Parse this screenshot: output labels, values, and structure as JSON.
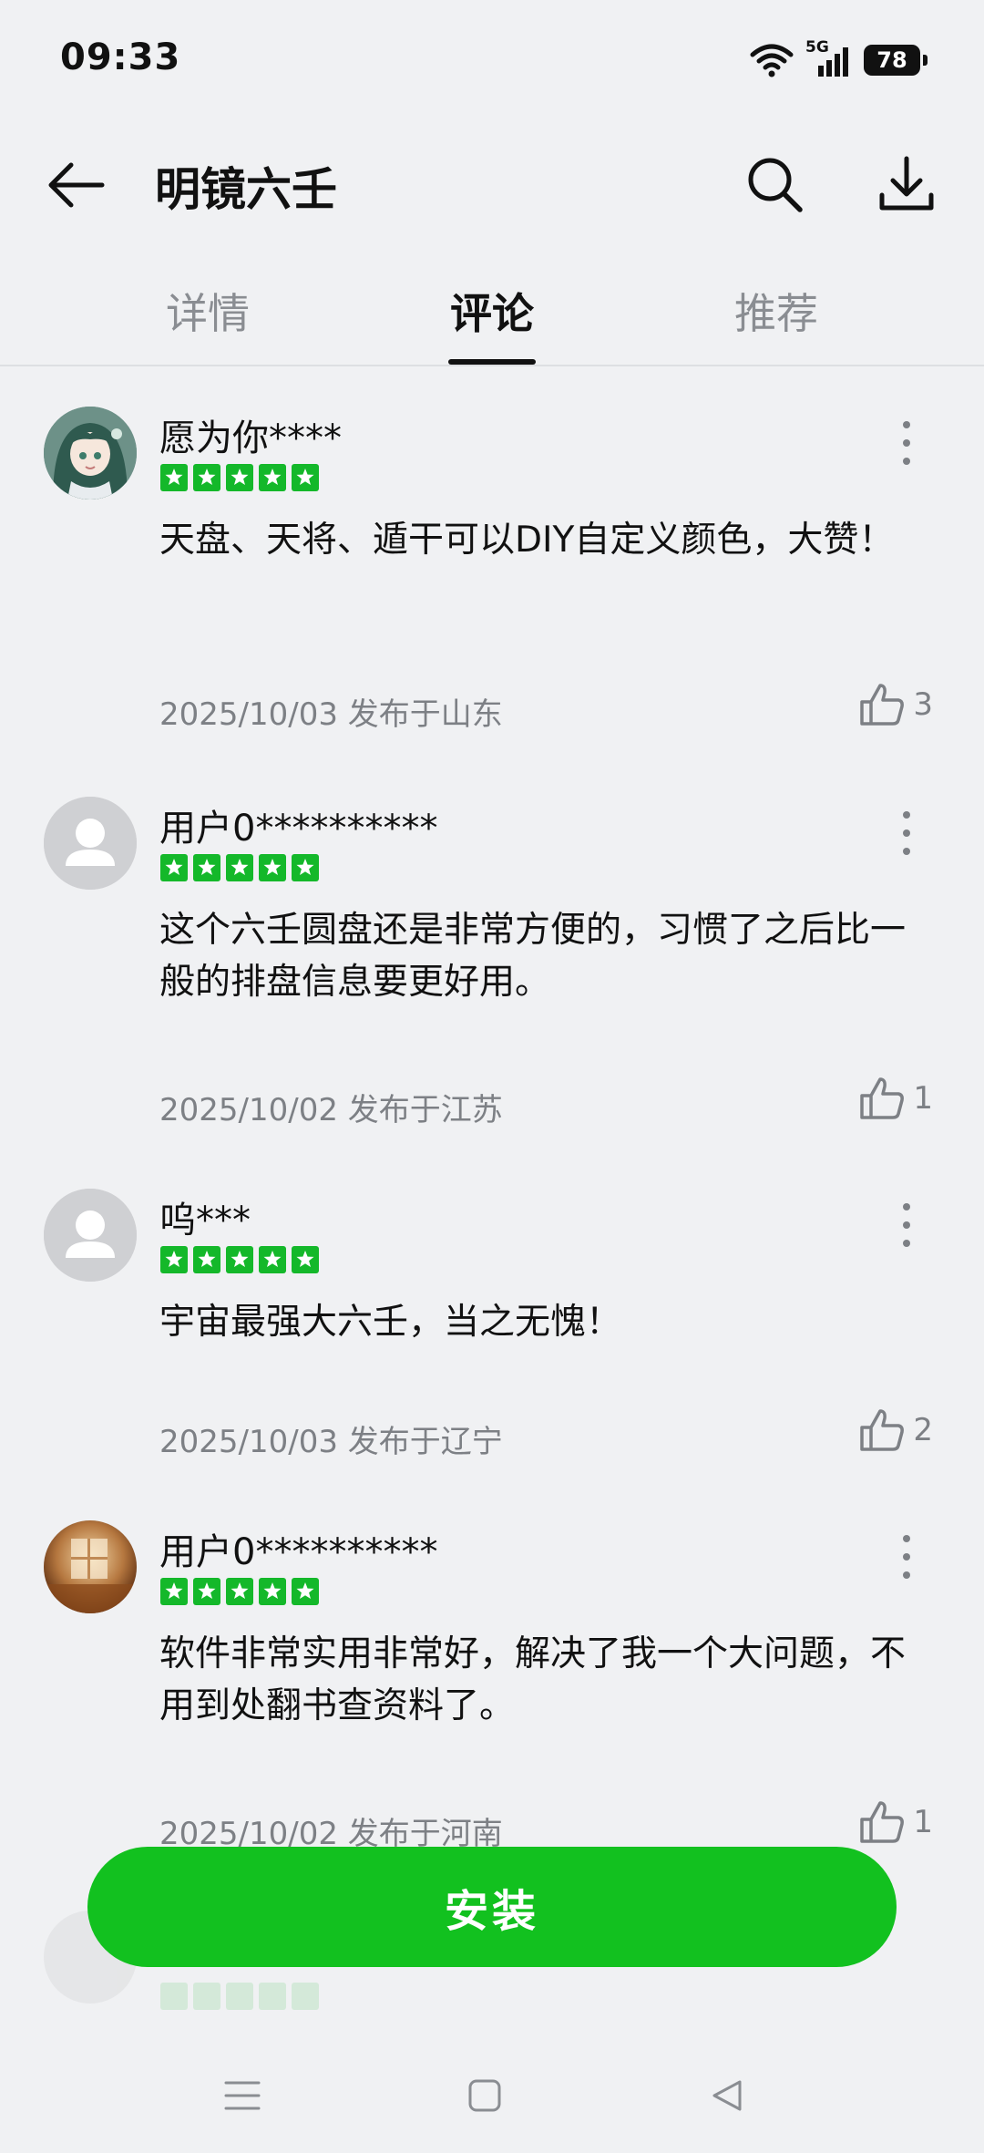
{
  "status_bar": {
    "time": "09:33",
    "network": "5G",
    "battery": "78"
  },
  "app_bar": {
    "title": "明镜六壬",
    "back_icon": "arrow-left-icon",
    "search_icon": "search-icon",
    "download_icon": "download-icon"
  },
  "tabs": [
    {
      "label": "详情",
      "active": false
    },
    {
      "label": "评论",
      "active": true
    },
    {
      "label": "推荐",
      "active": false
    }
  ],
  "reviews": [
    {
      "user": "愿为你****",
      "rating": 5,
      "text": "天盘、天将、遁干可以DIY自定义颜色，大赞！",
      "date": "2025/10/03",
      "location": "发布于山东",
      "likes": "3",
      "avatar": "anime-girl-avatar"
    },
    {
      "user": "用户0**********",
      "rating": 5,
      "text": "这个六壬圆盘还是非常方便的，习惯了之后比一般的排盘信息要更好用。",
      "date": "2025/10/02",
      "location": "发布于江苏",
      "likes": "1",
      "avatar": "default-avatar"
    },
    {
      "user": "呜***",
      "rating": 5,
      "text": "宇宙最强大六壬，当之无愧！",
      "date": "2025/10/03",
      "location": "发布于辽宁",
      "likes": "2",
      "avatar": "default-avatar"
    },
    {
      "user": "用户0**********",
      "rating": 5,
      "text": "软件非常实用非常好，解决了我一个大问题，不用到处翻书查资料了。",
      "date": "2025/10/02",
      "location": "发布于河南",
      "likes": "1",
      "avatar": "photo-avatar"
    }
  ],
  "install_button": {
    "label": "安装"
  },
  "colors": {
    "accent_green": "#12c11f",
    "star_green": "#14b82a",
    "background": "#f0f1f3",
    "muted_text": "#7d8085"
  },
  "nav_bar": {
    "menu_icon": "menu-icon",
    "home_icon": "home-square-icon",
    "back_icon": "back-triangle-icon"
  }
}
